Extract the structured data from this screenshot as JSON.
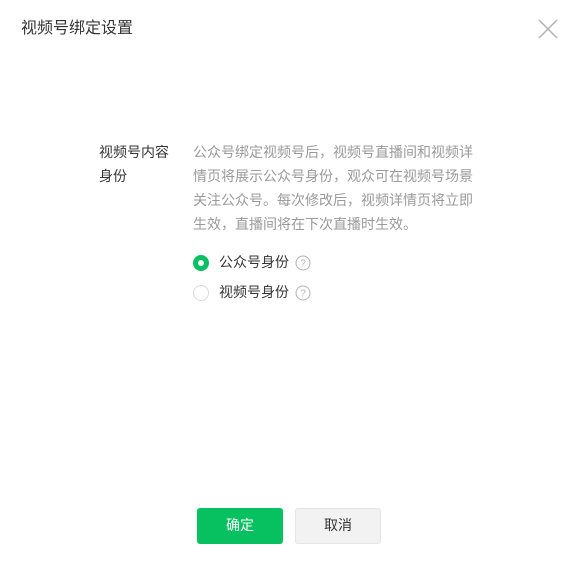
{
  "dialog": {
    "title": "视频号绑定设置",
    "close_icon": "close-icon"
  },
  "form": {
    "label": "视频号内容身份",
    "description": "公众号绑定视频号后，视频号直播间和视频详情页将展示公众号身份，观众可在视频号场景关注公众号。每次修改后，视频详情页将立即生效，直播间将在下次直播时生效。",
    "options": [
      {
        "label": "公众号身份",
        "checked": true,
        "help_icon": "question-circle-icon"
      },
      {
        "label": "视频号身份",
        "checked": false,
        "help_icon": "question-circle-icon"
      }
    ]
  },
  "footer": {
    "confirm_label": "确定",
    "cancel_label": "取消"
  },
  "colors": {
    "accent": "#07c160",
    "text": "#353535",
    "muted": "#9a9a9a"
  }
}
